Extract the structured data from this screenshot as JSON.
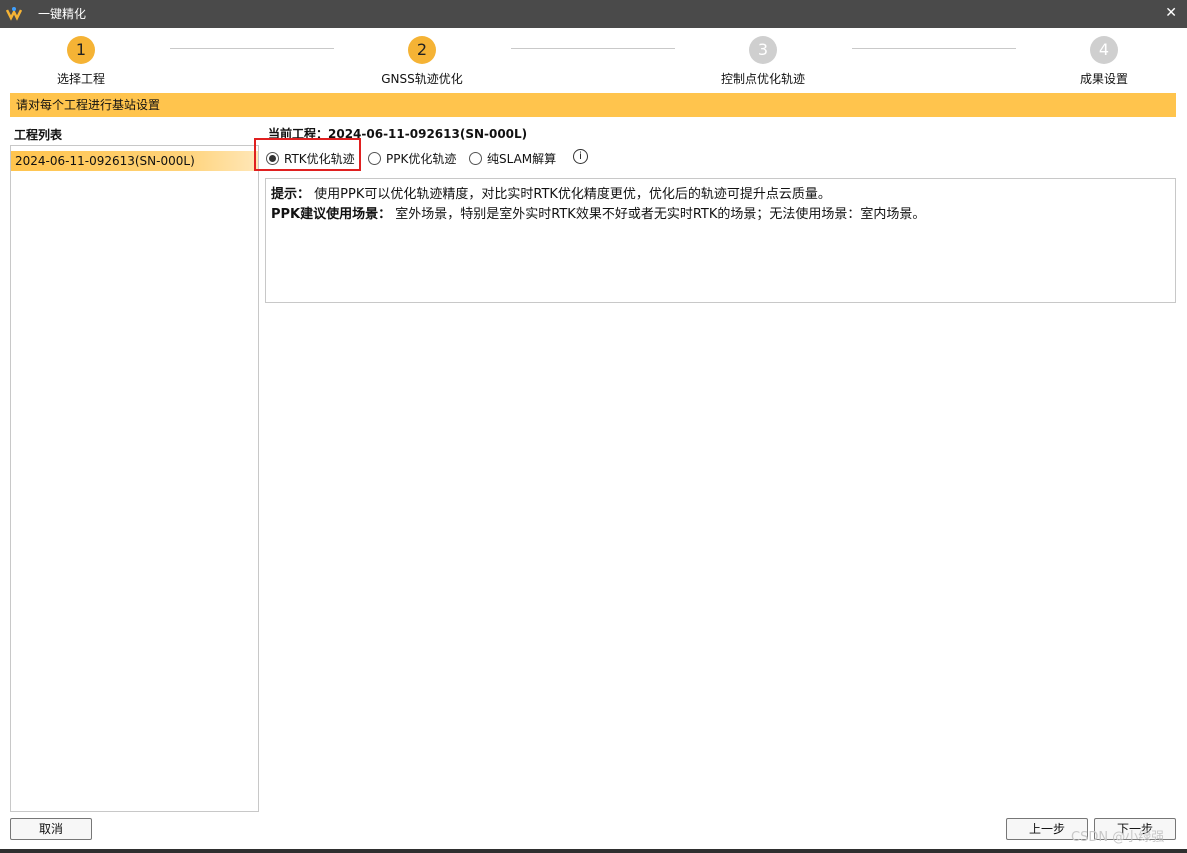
{
  "window": {
    "title": "一键精化",
    "close_glyph": "✕"
  },
  "colors": {
    "accent": "#f5b335",
    "banner": "#ffc44d",
    "inactive_step": "#cfcfcf",
    "titlebar": "#4a4a4a",
    "highlight_box": "#e02020"
  },
  "steps": [
    {
      "number": "1",
      "label": "选择工程",
      "state": "done"
    },
    {
      "number": "2",
      "label": "GNSS轨迹优化",
      "state": "active"
    },
    {
      "number": "3",
      "label": "控制点优化轨迹",
      "state": "inactive"
    },
    {
      "number": "4",
      "label": "成果设置",
      "state": "inactive"
    }
  ],
  "banner": "请对每个工程进行基站设置",
  "project_list": {
    "title": "工程列表",
    "items": [
      "2024-06-11-092613(SN-000L)"
    ]
  },
  "current_project": "当前工程：2024-06-11-092613(SN-000L)",
  "modes": {
    "options": [
      "RTK优化轨迹",
      "PPK优化轨迹",
      "纯SLAM解算"
    ],
    "selected": "RTK优化轨迹",
    "info_glyph": "i"
  },
  "tips": {
    "label1": "提示：",
    "text1": "使用PPK可以优化轨迹精度，对比实时RTK优化精度更优，优化后的轨迹可提升点云质量。",
    "label2": "PPK建议使用场景：",
    "text2": "室外场景，特别是室外实时RTK效果不好或者无实时RTK的场景；无法使用场景：室内场景。"
  },
  "buttons": {
    "cancel": "取消",
    "prev": "上一步",
    "next": "下一步"
  },
  "watermark": "CSDN @小绿强"
}
